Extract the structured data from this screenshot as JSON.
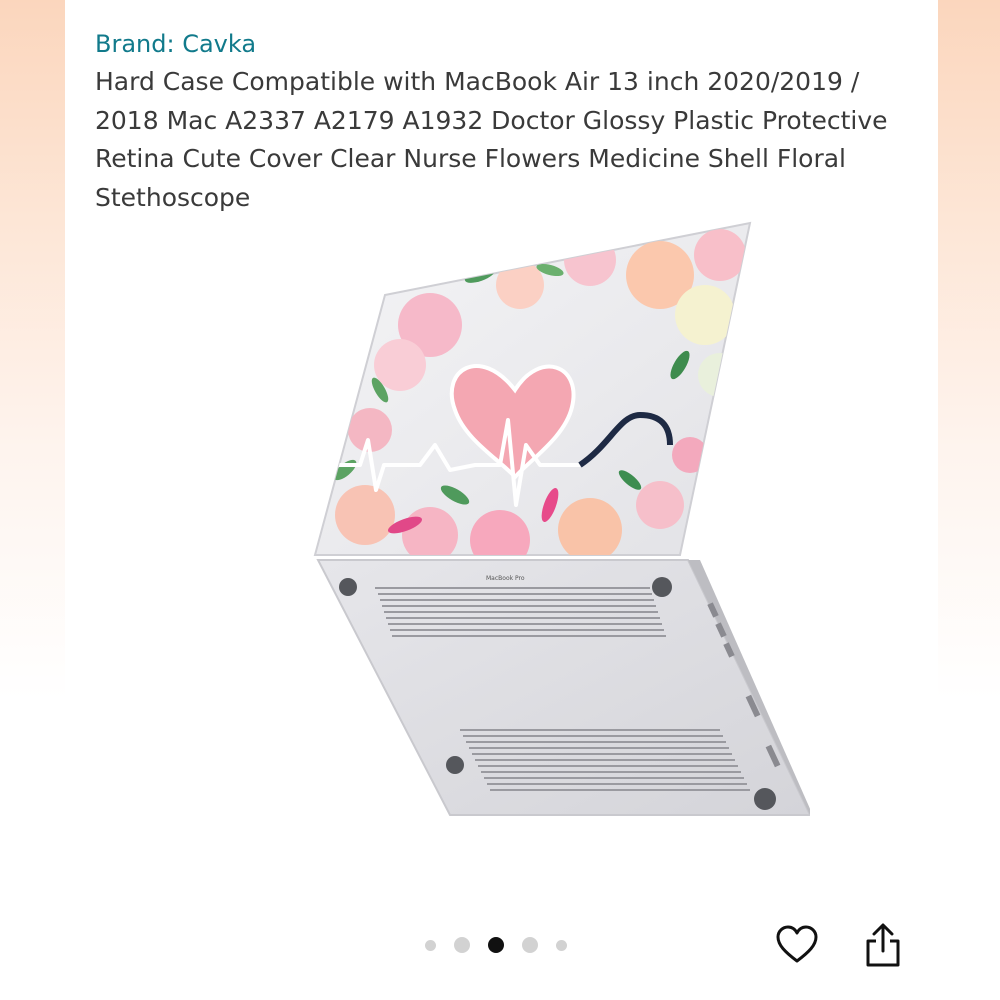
{
  "product": {
    "brand_label": "Brand: Cavka",
    "title": "Hard Case Compatible with MacBook Air 13 inch 2020/2019 / 2018 Mac A2337 A2179 A1932 Doctor Glossy Plastic Protective Retina Cute Cover Clear Nurse Flowers Medicine Shell Floral Stethoscope",
    "laptop_label": "MacBook Pro"
  },
  "gallery": {
    "dots": [
      {
        "state": "inactive",
        "size": "small"
      },
      {
        "state": "inactive",
        "size": "mid"
      },
      {
        "state": "active",
        "size": "mid"
      },
      {
        "state": "inactive",
        "size": "mid"
      },
      {
        "state": "inactive",
        "size": "small"
      }
    ],
    "current_index": 3,
    "total": 5
  },
  "actions": {
    "wishlist_icon": "heart-outline-icon",
    "share_icon": "share-icon"
  },
  "colors": {
    "brand_link": "#117a8b",
    "text": "#3a3a3a",
    "page_bg_edge": "#fbd6bd",
    "dot_active": "#111111",
    "dot_inactive": "#d2d2d2"
  }
}
